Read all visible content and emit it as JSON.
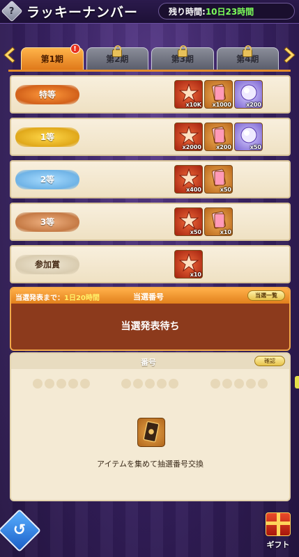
{
  "header": {
    "help_glyph": "?",
    "title": "ラッキーナンバー",
    "remaining_label": "残り時間:",
    "remaining_value": "10日23時間"
  },
  "tabs": [
    {
      "label": "第1期",
      "active": true,
      "badge": "!"
    },
    {
      "label": "第2期",
      "active": false,
      "locked": true
    },
    {
      "label": "第3期",
      "active": false,
      "locked": true
    },
    {
      "label": "第4期",
      "active": false,
      "locked": true
    }
  ],
  "prizes": [
    {
      "rank": "特等",
      "items": [
        {
          "icon": "ticket-star-icon",
          "qty": "x10K"
        },
        {
          "icon": "card-pack-icon",
          "qty": "x1000"
        },
        {
          "icon": "purple-orb-icon",
          "qty": "x200"
        }
      ]
    },
    {
      "rank": "1等",
      "items": [
        {
          "icon": "ticket-star-icon",
          "qty": "x2000"
        },
        {
          "icon": "card-pack-icon",
          "qty": "x200"
        },
        {
          "icon": "purple-orb-icon",
          "qty": "x50"
        }
      ]
    },
    {
      "rank": "2等",
      "items": [
        {
          "icon": "ticket-star-icon",
          "qty": "x400"
        },
        {
          "icon": "card-pack-icon",
          "qty": "x50"
        }
      ]
    },
    {
      "rank": "3等",
      "items": [
        {
          "icon": "ticket-star-icon",
          "qty": "x50"
        },
        {
          "icon": "card-pack-icon",
          "qty": "x10"
        }
      ]
    },
    {
      "rank": "参加賞",
      "items": [
        {
          "icon": "ticket-star-icon",
          "qty": "x10"
        }
      ]
    }
  ],
  "result": {
    "countdown_label": "当選発表まで：",
    "countdown_value": "1日20時間",
    "heading": "当選番号",
    "list_button": "当選一覧",
    "message": "当選発表待ち"
  },
  "numbers": {
    "heading": "番号",
    "confirm_button": "確認",
    "exchange_text": "アイテムを集めて抽選番号交換"
  },
  "footer": {
    "back_glyph": "↺",
    "gift_label": "ギフト"
  },
  "colors": {
    "accent_orange": "#e2801c",
    "timer_green": "#7cff5a",
    "panel_brown": "#8c3a1c"
  }
}
